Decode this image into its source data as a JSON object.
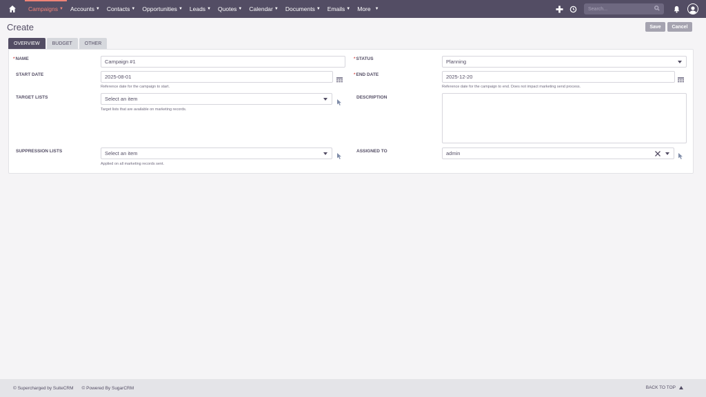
{
  "nav": {
    "items": [
      {
        "label": "Campaigns",
        "active": true
      },
      {
        "label": "Accounts"
      },
      {
        "label": "Contacts"
      },
      {
        "label": "Opportunities"
      },
      {
        "label": "Leads"
      },
      {
        "label": "Quotes"
      },
      {
        "label": "Calendar"
      },
      {
        "label": "Documents"
      },
      {
        "label": "Emails"
      },
      {
        "label": "More"
      }
    ],
    "search_placeholder": "Search...",
    "icons": [
      "home-icon",
      "plus-icon",
      "history-icon",
      "search-icon",
      "bell-icon",
      "user-avatar-icon"
    ]
  },
  "header": {
    "title": "Create",
    "save_label": "Save",
    "cancel_label": "Cancel"
  },
  "tabs": [
    {
      "label": "OVERVIEW",
      "active": true
    },
    {
      "label": "BUDGET"
    },
    {
      "label": "OTHER"
    }
  ],
  "form": {
    "name": {
      "label": "NAME",
      "required_mark": "*",
      "value": "Campaign #1"
    },
    "status": {
      "label": "STATUS",
      "required_mark": "*",
      "value": "Planning"
    },
    "start_date": {
      "label": "START DATE",
      "value": "2025-08-01",
      "help": "Reference date for the campaign to start."
    },
    "end_date": {
      "label": "END DATE",
      "required_mark": "*",
      "value": "2025-12-20",
      "help": "Reference date for the campaign to end. Does not impact marketing send process."
    },
    "target_lists": {
      "label": "TARGET LISTS",
      "placeholder": "Select an item",
      "help": "Target lists that are available on marketing records."
    },
    "description": {
      "label": "DESCRIPTION",
      "value": ""
    },
    "suppression_lists": {
      "label": "SUPPRESSION LISTS",
      "placeholder": "Select an item",
      "help": "Applied on all marketing records sent."
    },
    "assigned_to": {
      "label": "ASSIGNED TO",
      "value": "admin"
    }
  },
  "footer": {
    "supercharged": "© Supercharged by SuiteCRM",
    "powered": "© Powered By SugarCRM",
    "back_to_top": "BACK TO TOP"
  },
  "colors": {
    "navbar": "#534d64",
    "accent": "#f08377",
    "button": "#a5a3b0"
  }
}
